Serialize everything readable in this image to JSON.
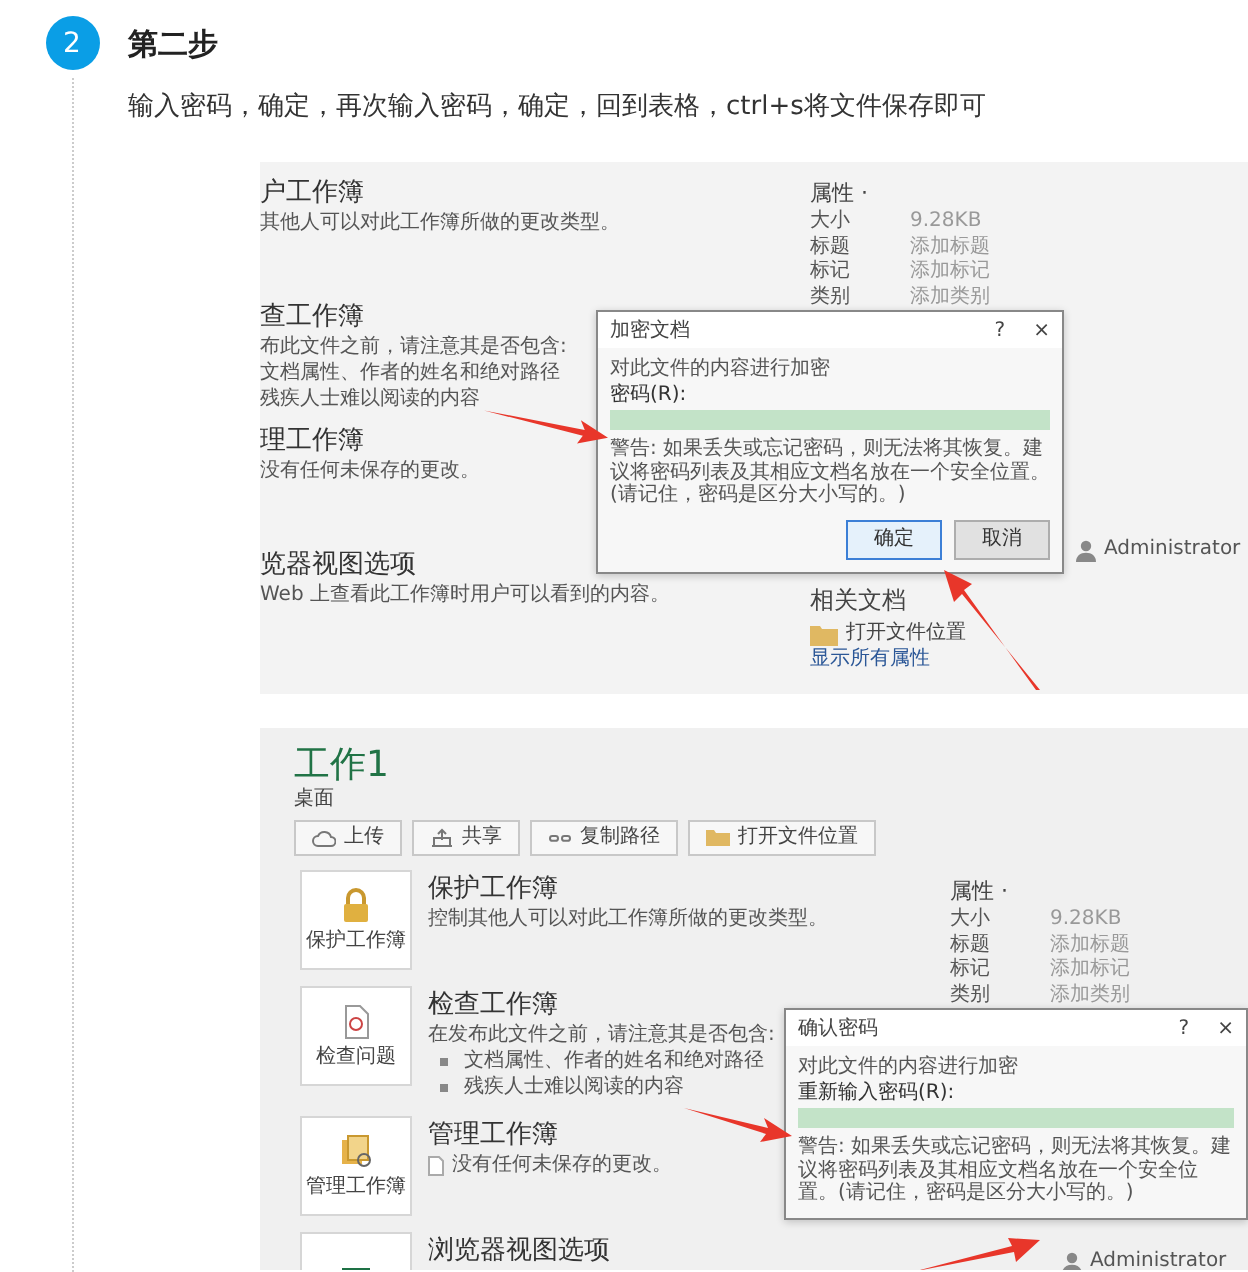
{
  "step": {
    "number": "2",
    "title": "第二步",
    "description": "输入密码，确定，再次输入密码，确定，回到表格，ctrl+s将文件保存即可"
  },
  "screenshot_1": {
    "sections": [
      {
        "title": "户工作簿",
        "lines": [
          "其他人可以对此工作簿所做的更改类型。"
        ]
      },
      {
        "title": "查工作簿",
        "lines": [
          "布此文件之前，请注意其是否包含:",
          "文档属性、作者的姓名和绝对路径",
          "残疾人士难以阅读的内容"
        ]
      },
      {
        "title": "理工作簿",
        "lines": [
          "没有任何未保存的更改。"
        ]
      },
      {
        "title": "览器视图选项",
        "lines": [
          "Web 上查看此工作簿时用户可以看到的内容。"
        ]
      }
    ],
    "properties": {
      "heading": "属性 ·",
      "rows": [
        {
          "label": "大小",
          "value": "9.28KB"
        },
        {
          "label": "标题",
          "value": "添加标题"
        },
        {
          "label": "标记",
          "value": "添加标记"
        },
        {
          "label": "类别",
          "value": "添加类别"
        }
      ]
    },
    "author": "Administrator",
    "related_docs": {
      "heading": "相关文档",
      "link": "打开文件位置"
    },
    "show_all": "显示所有属性",
    "dialog": {
      "title": "加密文档",
      "help": "?",
      "close": "×",
      "group": "对此文件的内容进行加密",
      "label": "密码(R):",
      "warning": "警告: 如果丢失或忘记密码，则无法将其恢复。建议将密码列表及其相应文档名放在一个安全位置。(请记住，密码是区分大小写的。)",
      "buttons": [
        {
          "label": "确定",
          "selected": true
        },
        {
          "label": "取消",
          "selected": false
        }
      ]
    }
  },
  "screenshot_2": {
    "title": "工作1",
    "location": "桌面",
    "actions": [
      {
        "kind": "upload",
        "label": "上传"
      },
      {
        "kind": "share",
        "label": "共享"
      },
      {
        "kind": "link",
        "label": "复制路径"
      },
      {
        "kind": "folder",
        "label": "打开文件位置"
      }
    ],
    "cards": [
      {
        "kind": "lock",
        "icon_label": "保护工作簿",
        "title": "保护工作簿",
        "lines": [
          "控制其他人可以对此工作簿所做的更改类型。"
        ]
      },
      {
        "kind": "inspect",
        "icon_label": "检查问题",
        "title": "检查工作簿",
        "lines": [
          "在发布此文件之前，请注意其是否包含:"
        ],
        "bullets": [
          "文档属性、作者的姓名和绝对路径",
          "残疾人士难以阅读的内容"
        ]
      },
      {
        "kind": "manage",
        "icon_label": "管理工作簿",
        "title": "管理工作簿",
        "lines": [
          "没有任何未保存的更改。"
        ]
      },
      {
        "kind": "excel",
        "title": "浏览器视图选项"
      }
    ],
    "properties": {
      "heading": "属性 ·",
      "rows": [
        {
          "label": "大小",
          "value": "9.28KB"
        },
        {
          "label": "标题",
          "value": "添加标题"
        },
        {
          "label": "标记",
          "value": "添加标记"
        },
        {
          "label": "类别",
          "value": "添加类别"
        }
      ]
    },
    "author": "Administrator",
    "dialog": {
      "title": "确认密码",
      "help": "?",
      "close": "×",
      "group": "对此文件的内容进行加密",
      "label": "重新输入密码(R):",
      "warning": "警告: 如果丢失或忘记密码，则无法将其恢复。建议将密码列表及其相应文档名放在一个安全位置。(请记住，密码是区分大小写的。)"
    }
  }
}
